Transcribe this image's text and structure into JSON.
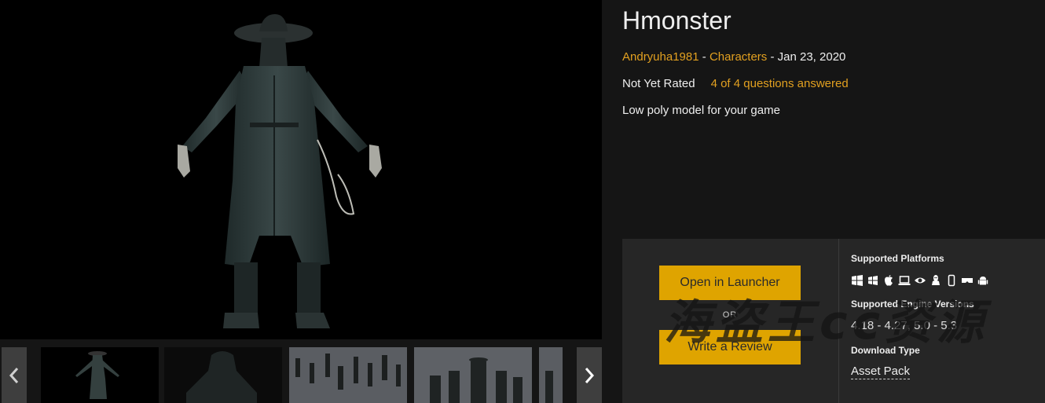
{
  "gallery": {
    "prev_icon": "chevron-left-icon",
    "next_icon": "chevron-right-icon",
    "thumbnails": [
      {
        "name": "thumb-front-view",
        "active": true
      },
      {
        "name": "thumb-closeup",
        "active": false
      },
      {
        "name": "thumb-crowd-scene",
        "active": false
      },
      {
        "name": "thumb-group-scene",
        "active": false
      },
      {
        "name": "thumb-partial",
        "active": false
      }
    ]
  },
  "product": {
    "title": "Hmonster",
    "seller": "Andryuha1981",
    "separator_1": " - ",
    "category": "Characters",
    "separator_2": " - ",
    "date": "Jan 23, 2020",
    "rating": "Not Yet Rated",
    "questions": "4 of 4 questions answered",
    "summary": "Low poly model for your game"
  },
  "actions": {
    "open_launcher": "Open in Launcher",
    "or": "OR",
    "write_review": "Write a Review"
  },
  "info": {
    "platforms_heading": "Supported Platforms",
    "platform_icons": [
      "windows-icon",
      "windows-store-icon",
      "apple-icon",
      "laptop-icon",
      "eye-icon",
      "linux-icon",
      "mobile-icon",
      "vr-headset-icon",
      "android-icon"
    ],
    "engine_heading": "Supported Engine Versions",
    "engine_versions": "4.18 - 4.27, 5.0 - 5.3",
    "download_heading": "Download Type",
    "download_type": "Asset Pack"
  },
  "watermark": "海盗王cc资源",
  "colors": {
    "accent": "#e2a020",
    "button": "#dfa400",
    "panel": "#262626",
    "background": "#151515"
  }
}
